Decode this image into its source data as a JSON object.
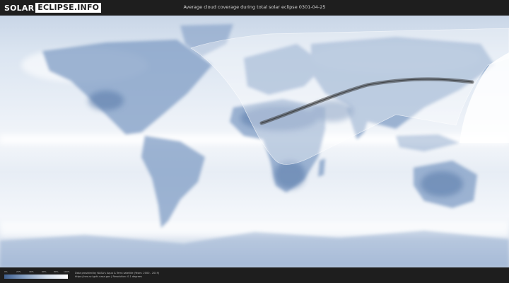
{
  "header": {
    "logo_left": "SOLAR",
    "logo_right": "ECLIPSE.INFO",
    "title": "Average cloud coverage during total solar eclipse 0301-04-25"
  },
  "footer": {
    "scale_ticks": [
      "0%",
      "20%",
      "40%",
      "60%",
      "80%",
      "100%"
    ],
    "credit_line1": "Data provided by NASA's Aqua & Terra satellite (Years: 2000 - 2019)",
    "credit_line2": "https://neo.sci.gsfc.nasa.gov  |  Resolution: 0.1 degrees"
  },
  "colors": {
    "background": "#1e1e1e",
    "cloud_white": "#f2f6fb",
    "land_clear": "#6f8fba",
    "eclipse_zone": "#ffffff",
    "totality_path": "#3a3a3a"
  }
}
